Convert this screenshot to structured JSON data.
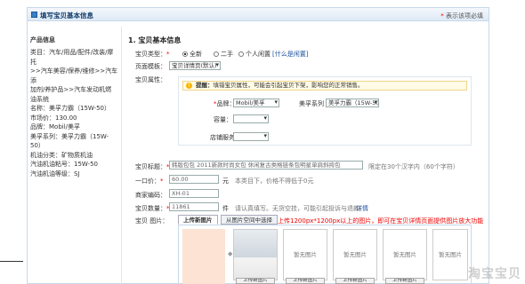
{
  "header": {
    "title": "填写宝贝基本信息",
    "required_note": "表示该项必填",
    "required_star": "*"
  },
  "sidebar": {
    "heading": "产品信息",
    "lines": [
      "类目：汽车/用品/配件/改装/摩托",
      ">>汽车美容/保养/维修>>汽车添",
      "加剂/养护品>>汽车发动机燃",
      "油系统",
      "名称：美孚力霸（15W-50）",
      "市场价：130.00",
      "品牌：Mobil/美孚",
      "美孚系列：美孚力霸（15W-50）",
      "机油分类：矿物质机油",
      "汽油机油粘号：15W-50",
      "汽油机油等级：SJ"
    ]
  },
  "section": {
    "title": "1. 宝贝基本信息"
  },
  "type": {
    "label": "宝贝类型：",
    "star": "*",
    "opt1": "全新",
    "opt2": "二手",
    "opt3": "个人闲置",
    "link": "[什么是闲置]"
  },
  "template": {
    "label": "页面模板：",
    "value": "宝贝详情页(默认)"
  },
  "attr": {
    "label": "宝贝属性：",
    "tip_bold": "提醒：",
    "tip": "填错宝贝属性，可能会引起宝贝下架，影响您的正常销售。",
    "brand_label": "品牌：",
    "brand_star": "*",
    "brand_value": "Mobil/美孚",
    "series_label": "美孚系列",
    "series_value": "美孚力霸（15W-50）",
    "cap_label": "容量：",
    "store_label": "店铺服务："
  },
  "title_field": {
    "label": "宝贝标题：",
    "star": "*",
    "value": "韩版包包 2011新款时尚女包 休闲复古类格链条包明星单肩斜挎包",
    "hint": "限定在30个汉字内（60个字符）"
  },
  "price": {
    "label": "一口价：",
    "star": "*",
    "value": "60.00",
    "unit": "元",
    "hint": "本类目下，价格不得低于0元"
  },
  "code": {
    "label": "商家编码：",
    "value": "XH-01"
  },
  "qty": {
    "label": "宝贝数量：",
    "star": "*",
    "value": "11861",
    "unit": "件",
    "hint": "请认真填写。无货空挂，可能引起投诉与退款。",
    "link": "详情"
  },
  "images": {
    "label": "宝贝 图片：",
    "tab1": "上传新图片",
    "tab2": "从图片空间中选择",
    "note": "上传1200px*1200px以上的图片，即可在宝贝详情页面提供图片放大功能",
    "no_image": "暂无图片",
    "upload": "上传新图片"
  },
  "watermark": "淘宝宝贝"
}
